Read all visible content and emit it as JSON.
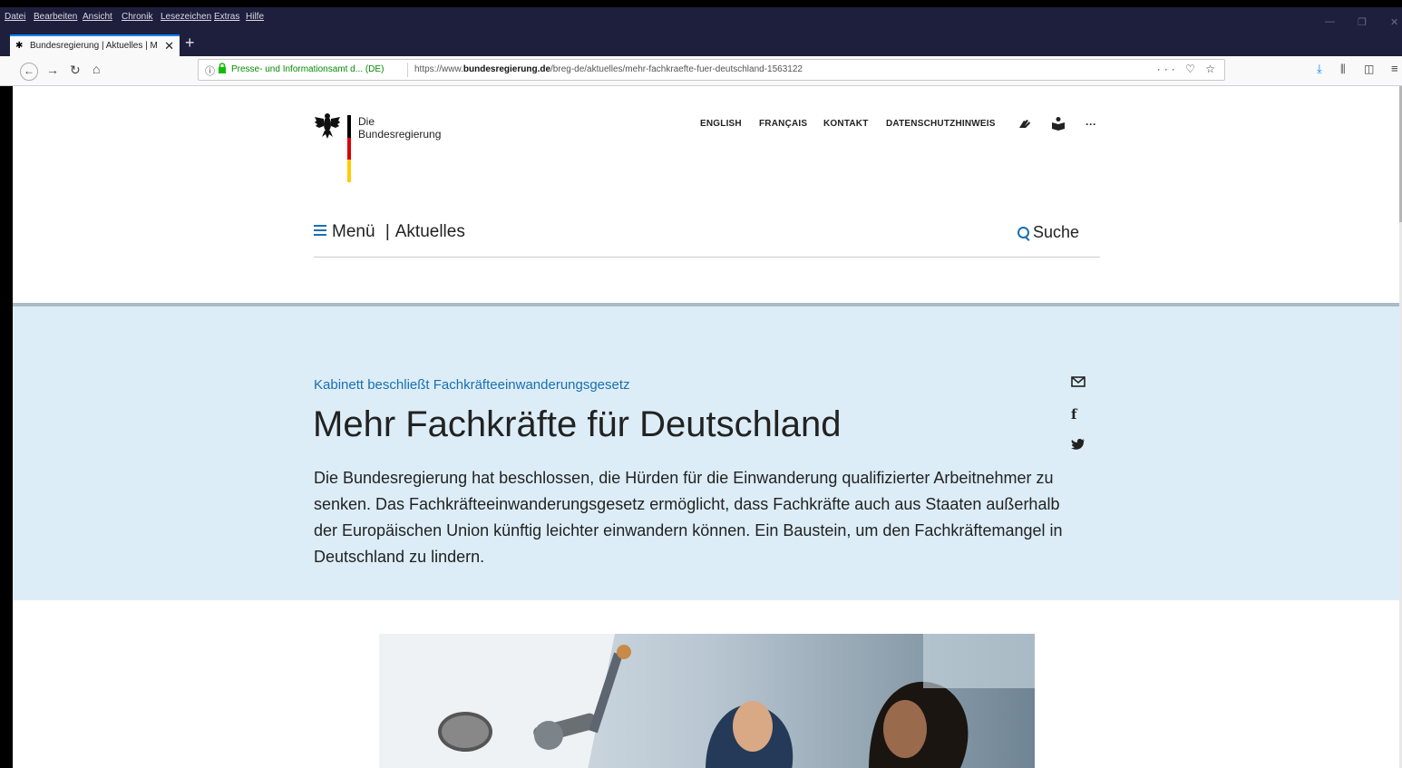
{
  "browser": {
    "menubar": [
      "Datei",
      "Bearbeiten",
      "Ansicht",
      "Chronik",
      "Lesezeichen",
      "Extras",
      "Hilfe"
    ],
    "tab_title": "Bundesregierung | Aktuelles | M",
    "url_identity": "Presse- und Informationsamt d... (DE)",
    "url_prefix": "https://www.",
    "url_domain": "bundesregierung.de",
    "url_path": "/breg-de/aktuelles/mehr-fachkraefte-fuer-deutschland-1563122"
  },
  "site": {
    "logo_line1": "Die",
    "logo_line2": "Bundesregierung",
    "top_links": [
      "ENGLISH",
      "FRANÇAIS",
      "KONTAKT",
      "DATENSCHUTZHINWEIS"
    ],
    "more": "···",
    "menu_label": "Menü",
    "section_label": "Aktuelles",
    "search_label": "Suche"
  },
  "article": {
    "kicker": "Kabinett beschließt Fachkräfteeinwanderungsgesetz",
    "headline": "Mehr Fachkräfte für Deutschland",
    "lead": "Die Bundesregierung hat beschlossen, die Hürden für die Einwanderung qualifizierter Arbeitnehmer zu senken. Das Fachkräfteeinwanderungsgesetz ermöglicht, dass Fachkräfte auch aus Staaten außerhalb der Europäischen Union künftig leichter einwandern können. Ein Baustein, um den Fachkräftemangel in Deutschland zu lindern."
  },
  "colors": {
    "accent": "#1a6fb0",
    "hero_bg": "#dcedf7",
    "flag_black": "#000000",
    "flag_red": "#dd0000",
    "flag_gold": "#ffcc00"
  }
}
